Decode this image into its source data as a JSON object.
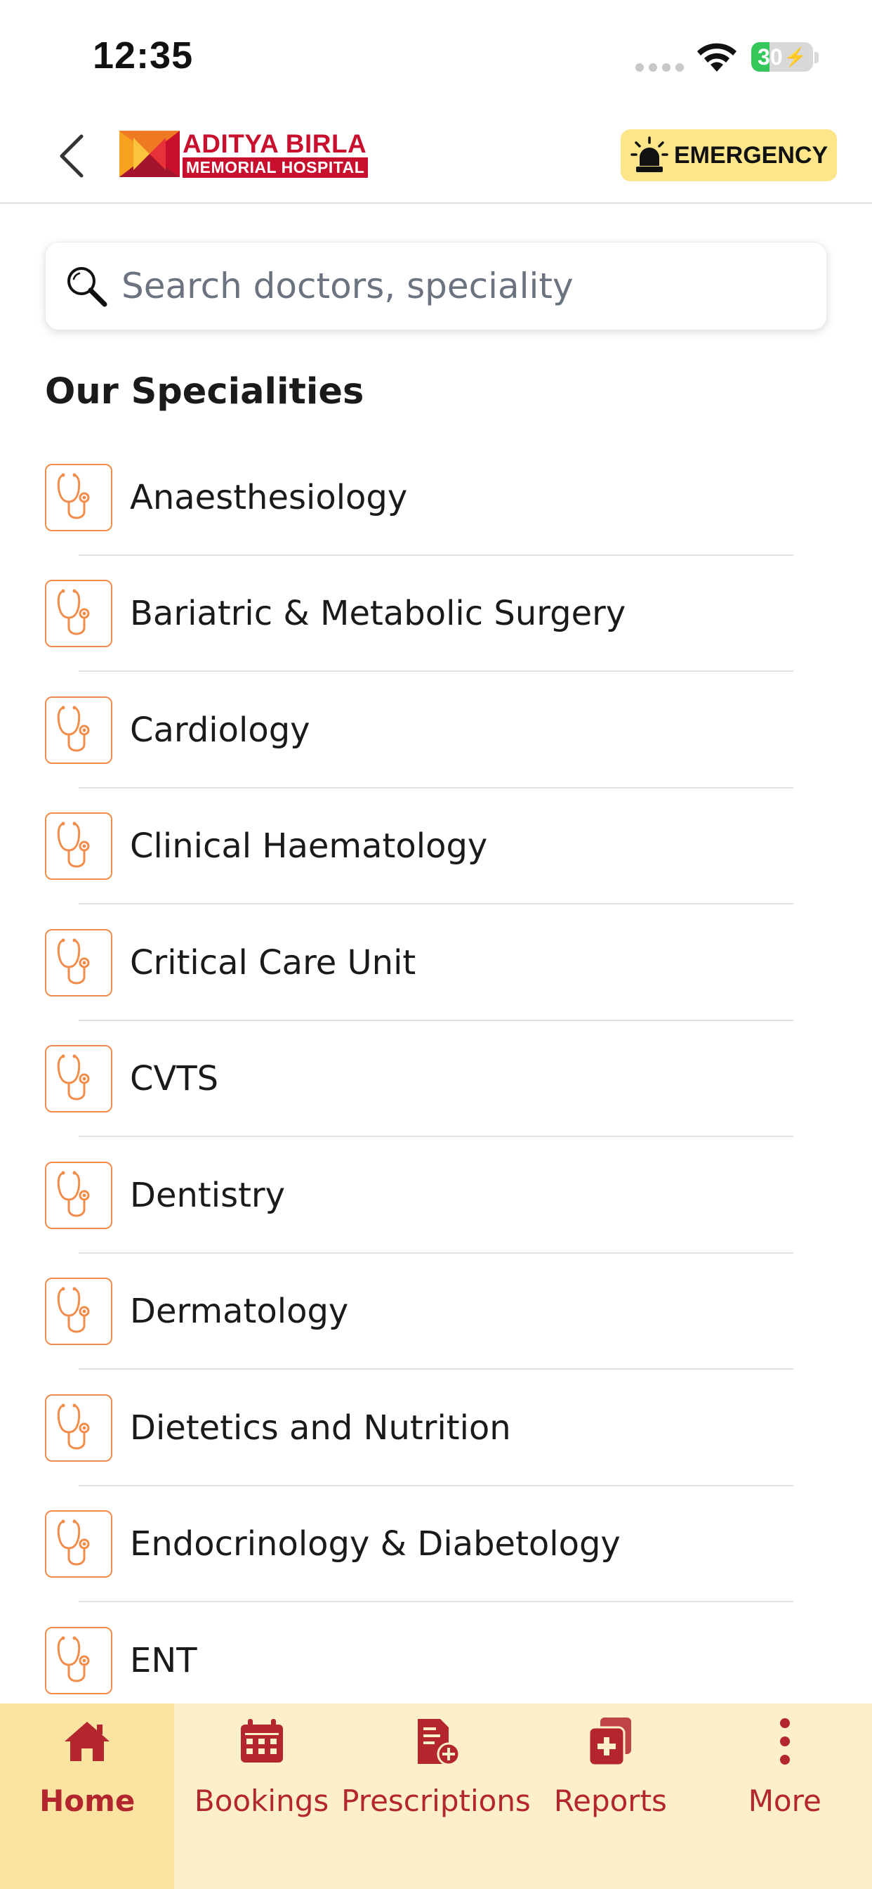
{
  "status_bar": {
    "time": "12:35",
    "battery_text": "30",
    "battery_level": 0.3,
    "battery_color": "#35c759"
  },
  "header": {
    "back_icon": "chevron-left-icon",
    "logo": {
      "line1": "ADITYA BIRLA",
      "line2": "MEMORIAL HOSPITAL",
      "brand_color": "#c8102e"
    },
    "emergency": {
      "label": "EMERGENCY",
      "icon": "siren-icon",
      "bg_color": "#fde68a"
    }
  },
  "search": {
    "placeholder": "Search doctors, speciality",
    "value": "",
    "icon": "search-icon"
  },
  "specialities": {
    "title": "Our Specialities",
    "icon": "stethoscope-icon",
    "icon_color": "#f28c4a",
    "items": [
      "Anaesthesiology",
      "Bariatric & Metabolic Surgery",
      "Cardiology",
      "Clinical Haematology",
      "Critical Care Unit",
      "CVTS",
      "Dentistry",
      "Dermatology",
      "Dietetics and Nutrition",
      "Endocrinology & Diabetology",
      "ENT"
    ]
  },
  "bottom_nav": {
    "accent_color": "#b3262e",
    "items": [
      {
        "label": "Home",
        "icon": "home-icon",
        "active": true
      },
      {
        "label": "Bookings",
        "icon": "calendar-icon",
        "active": false
      },
      {
        "label": "Prescriptions",
        "icon": "prescription-icon",
        "active": false
      },
      {
        "label": "Reports",
        "icon": "reports-icon",
        "active": false
      },
      {
        "label": "More",
        "icon": "more-vertical-icon",
        "active": false
      }
    ]
  }
}
